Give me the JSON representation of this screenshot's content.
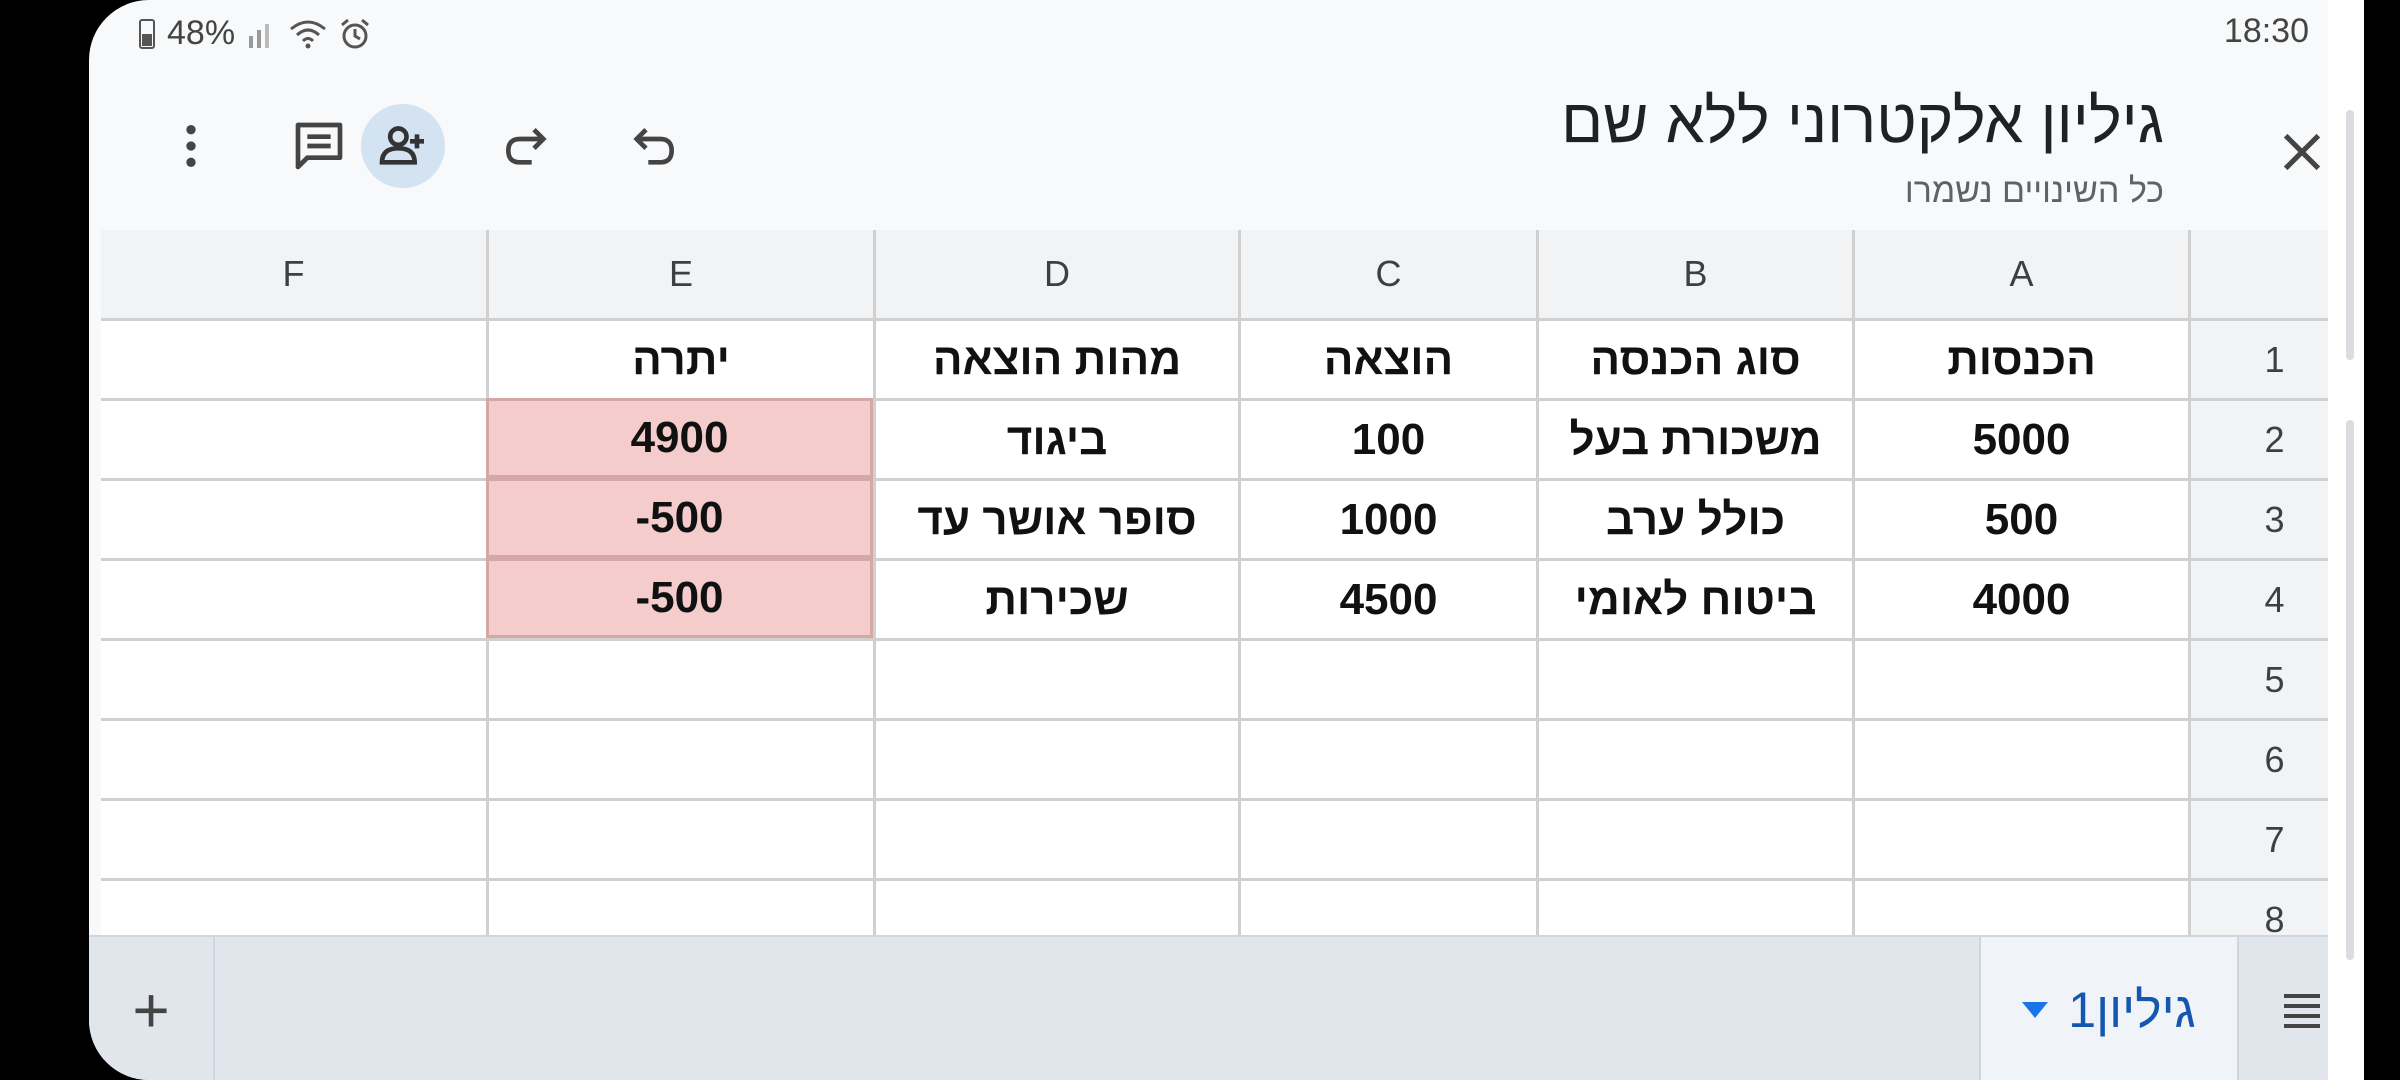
{
  "status": {
    "battery": "48%",
    "time": "18:30"
  },
  "appbar": {
    "title": "גיליון אלקטרוני ללא שם",
    "save_status": "כל השינויים נשמרו"
  },
  "columns": [
    "A",
    "B",
    "C",
    "D",
    "E",
    "F"
  ],
  "rows": [
    "1",
    "2",
    "3",
    "4",
    "5",
    "6",
    "7",
    "8"
  ],
  "cells": {
    "A1": "הכנסות",
    "B1": "סוג הכנסה",
    "C1": "הוצאה",
    "D1": "מהות הוצאה",
    "E1": "יתרה",
    "A2": "5000",
    "B2": "משכורת בעל",
    "C2": "100",
    "D2": "ביגוד",
    "E2": "4900",
    "A3": "500",
    "B3": "כולל ערב",
    "C3": "1000",
    "D3": "סופר אושר עד",
    "E3": "-500",
    "A4": "4000",
    "B4": "ביטוח לאומי",
    "C4": "4500",
    "D4": "שכירות",
    "E4": "-500"
  },
  "highlight_color": "#f4cccc",
  "bottombar": {
    "add_label": "+",
    "sheet_tab": "גיליון1"
  },
  "icons": [
    "more-vert-icon",
    "comment-icon",
    "add-person-icon",
    "redo-icon",
    "undo-icon",
    "close-icon",
    "sheets-list-icon",
    "dropdown-icon"
  ]
}
